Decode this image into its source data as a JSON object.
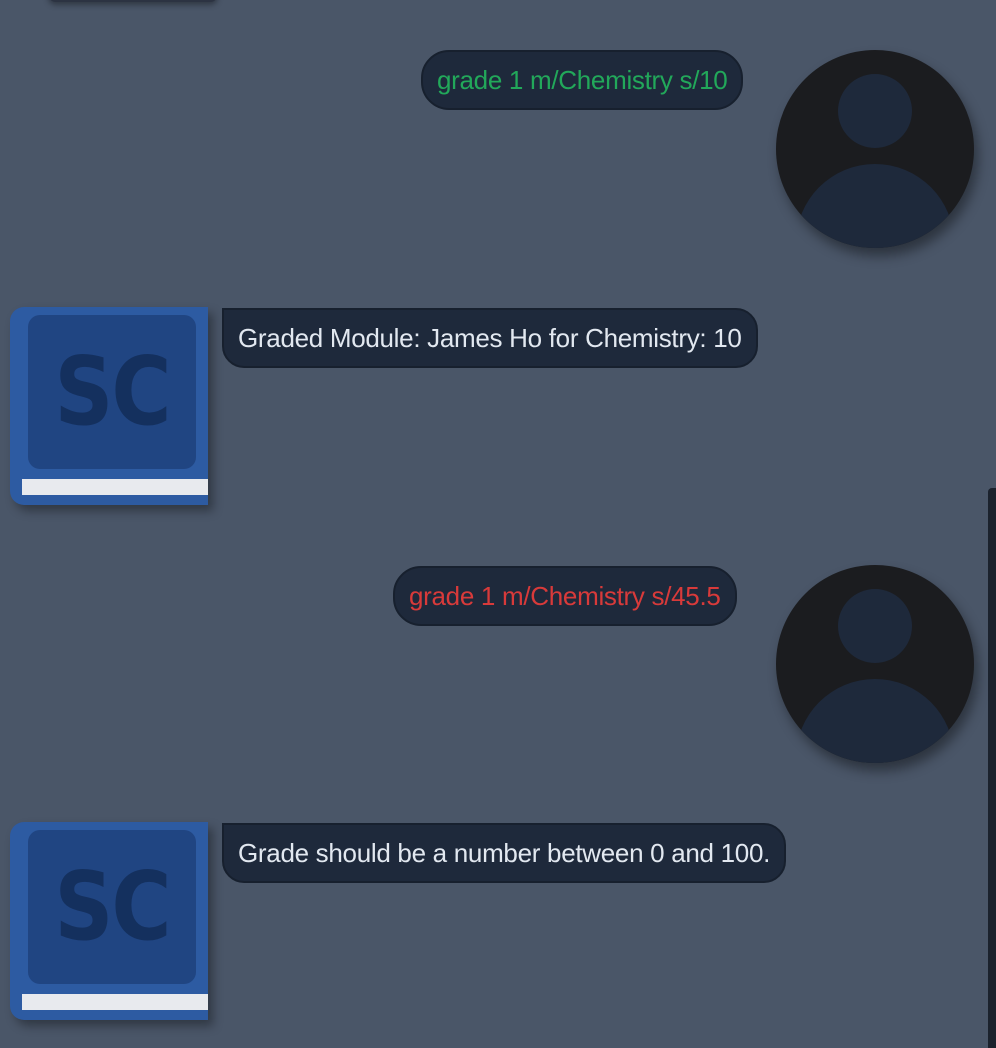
{
  "messages": [
    {
      "sender": "user",
      "status": "success",
      "text": "grade 1 m/Chemistry s/10",
      "avatar": "user-silhouette-icon"
    },
    {
      "sender": "bot",
      "status": "info",
      "text": "Graded Module: James Ho for Chemistry: 10",
      "avatar": "book-logo-icon",
      "avatar_text": "SC"
    },
    {
      "sender": "user",
      "status": "error",
      "text": "grade 1 m/Chemistry s/45.5",
      "avatar": "user-silhouette-icon"
    },
    {
      "sender": "bot",
      "status": "info",
      "text": "Grade should be a number between 0 and 100.",
      "avatar": "book-logo-icon",
      "avatar_text": "SC"
    }
  ],
  "colors": {
    "background": "#4a5668",
    "bubble": "#1e293b",
    "success_text": "#22a85a",
    "error_text": "#d83a3a",
    "bot_text": "#e2e8f0",
    "bot_avatar": "#2d5ba2"
  }
}
